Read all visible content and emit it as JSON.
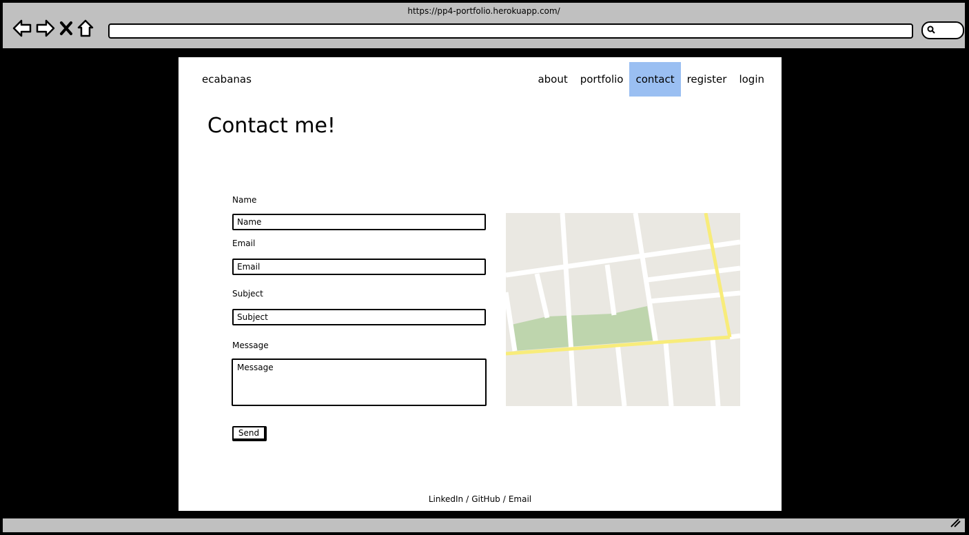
{
  "browser": {
    "url": "https://pp4-portfolio.herokuapp.com/",
    "icons": [
      "back-icon",
      "forward-icon",
      "stop-icon",
      "home-icon",
      "search-icon",
      "resize-grip-icon"
    ]
  },
  "nav": {
    "brand": "ecabanas",
    "items": [
      {
        "label": "about"
      },
      {
        "label": "portfolio"
      },
      {
        "label": "contact",
        "active": true
      },
      {
        "label": "register"
      },
      {
        "label": "login"
      }
    ],
    "active_color": "#9abff2"
  },
  "main": {
    "title": "Contact me!",
    "form": {
      "name_label": "Name",
      "name_placeholder": "Name",
      "email_label": "Email",
      "email_placeholder": "Email",
      "subject_label": "Subject",
      "subject_placeholder": "Subject",
      "message_label": "Message",
      "message_placeholder": "Message",
      "send_label": "Send"
    },
    "map": {
      "colors": {
        "background": "#eae8e2",
        "street": "#ffffff",
        "highway": "#f8ec7a",
        "park": "#bed5ad"
      }
    }
  },
  "footer": {
    "links": [
      "LinkedIn",
      "GitHub",
      "Email"
    ],
    "separator": "/"
  }
}
